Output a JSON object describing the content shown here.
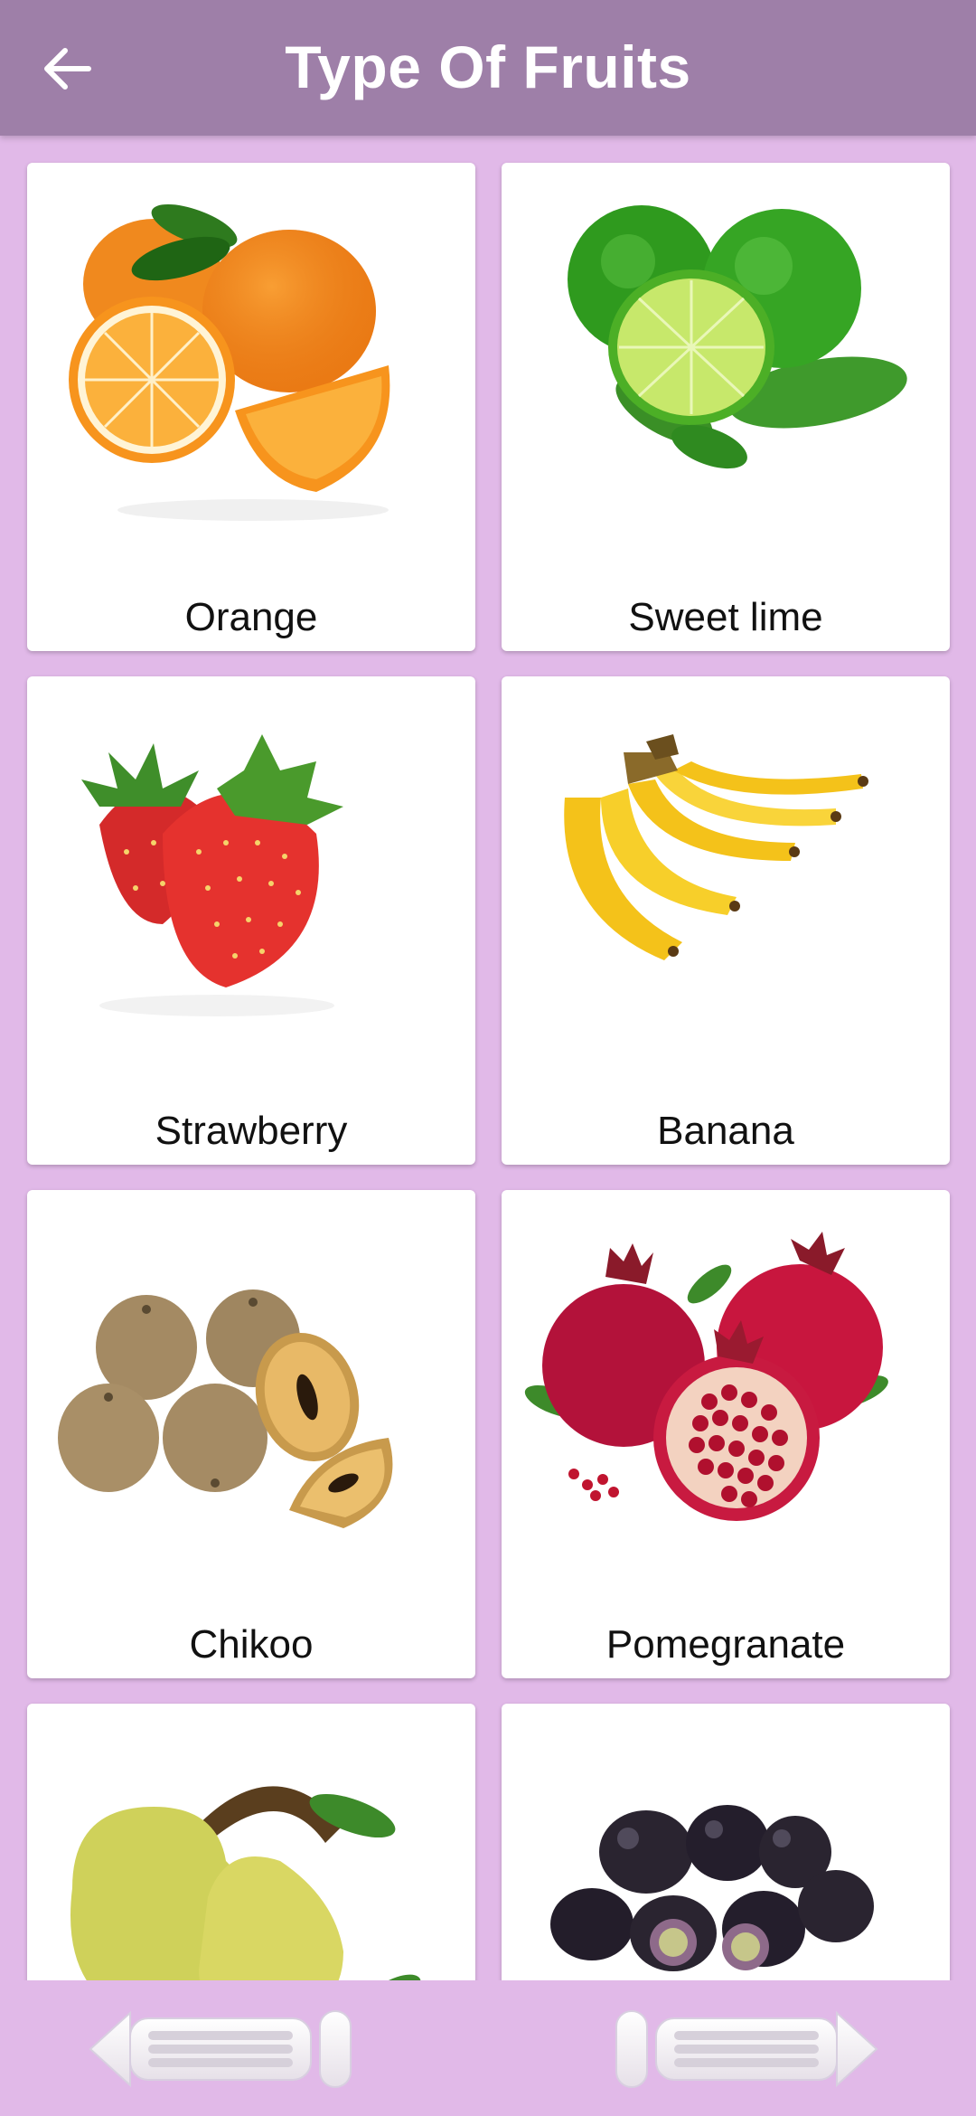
{
  "appbar": {
    "title": "Type Of Fruits",
    "back_icon": "arrow-left-icon",
    "background": "#9e7fa8"
  },
  "fruits": [
    {
      "label": "Orange",
      "image": "orange-photo"
    },
    {
      "label": "Sweet lime",
      "image": "sweet-lime-photo"
    },
    {
      "label": "Strawberry",
      "image": "strawberry-photo"
    },
    {
      "label": "Banana",
      "image": "banana-photo"
    },
    {
      "label": "Chikoo",
      "image": "chikoo-photo"
    },
    {
      "label": "Pomegranate",
      "image": "pomegranate-photo"
    },
    {
      "label": "",
      "image": "pear-photo"
    },
    {
      "label": "",
      "image": "jamun-photo"
    }
  ],
  "bottom_nav": {
    "prev_icon": "previous-arrow-icon",
    "next_icon": "next-arrow-icon"
  },
  "colors": {
    "page_background": "#e1b9e8",
    "card_background": "#ffffff"
  }
}
